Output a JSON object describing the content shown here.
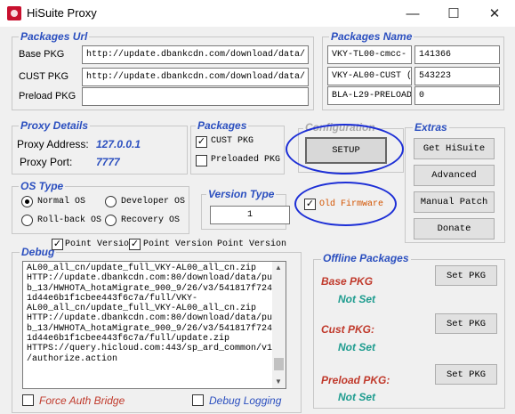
{
  "window": {
    "title": "HiSuite Proxy",
    "minimize": "—",
    "maximize": "☐",
    "close": "✕"
  },
  "packages_url": {
    "legend": "Packages Url",
    "base_label": "Base PKG",
    "base_value": "http://update.dbankcdn.com/download/data/",
    "cust_label": "CUST PKG",
    "cust_value": "http://update.dbankcdn.com/download/data/",
    "preload_label": "Preload PKG",
    "preload_value": ""
  },
  "packages_name": {
    "legend": "Packages Name",
    "base_name": "VKY-TL00-cmcc-",
    "base_id": "141366",
    "cust_name": "VKY-AL00-CUST (",
    "cust_id": "543223",
    "preload_name": "BLA-L29-PRELOAD",
    "preload_id": "0"
  },
  "proxy_details": {
    "legend": "Proxy Details",
    "address_label": "Proxy Address:",
    "address_value": "127.0.0.1",
    "port_label": "Proxy Port:",
    "port_value": "7777"
  },
  "packages": {
    "legend": "Packages",
    "cust_label": "CUST PKG",
    "cust_checked": true,
    "preloaded_label": "Preloaded PKG",
    "preloaded_checked": false
  },
  "configuration": {
    "legend": "Configuration",
    "setup_label": "SETUP",
    "old_firmware_label": "Old Firmware",
    "old_firmware_checked": true
  },
  "extras": {
    "legend": "Extras",
    "get_hisuite": "Get HiSuite",
    "advanced": "Advanced",
    "manual_patch": "Manual Patch",
    "donate": "Donate"
  },
  "os_type": {
    "legend": "OS Type",
    "normal": "Normal OS",
    "developer": "Developer OS",
    "rollback": "Roll-back OS",
    "recovery": "Recovery OS",
    "selected": "normal"
  },
  "version_type": {
    "legend": "Version Type",
    "value": "1"
  },
  "debug": {
    "legend": "Debug",
    "check1": "Point Version",
    "check2": "Point Version",
    "check3": "Point Version",
    "log": "AL00_all_cn/update_full_VKY-AL00_all_cn.zip\nHTTP://update.dbankcdn.com:80/download/data/pu\nb_13/HWHOTA_hotaMigrate_900_9/26/v3/541817f724\n1d44e6b1f1cbee443f6c7a/full/VKY-\nAL00_all_cn/update_full_VKY-AL00_all_cn.zip\nHTTP://update.dbankcdn.com:80/download/data/pu\nb_13/HWHOTA_hotaMigrate_900_9/26/v3/541817f724\n1d44e6b1f1cbee443f6c7a/full/update.zip\nHTTPS://query.hicloud.com:443/sp_ard_common/v1\n/authorize.action",
    "force_auth": "Force Auth Bridge",
    "debug_logging": "Debug Logging"
  },
  "offline": {
    "legend": "Offline Packages",
    "base_label": "Base PKG",
    "base_status": "Not Set",
    "base_btn": "Set PKG",
    "cust_label": "Cust PKG:",
    "cust_status": "Not Set",
    "cust_btn": "Set PKG",
    "preload_label": "Preload PKG:",
    "preload_status": "Not Set",
    "preload_btn": "Set PKG"
  },
  "colors": {
    "legend_blue": "#2b4fbf",
    "red": "#c0392b",
    "teal": "#1e9c8f",
    "annotation_blue": "#1d2fd6",
    "orange": "#d35400"
  }
}
